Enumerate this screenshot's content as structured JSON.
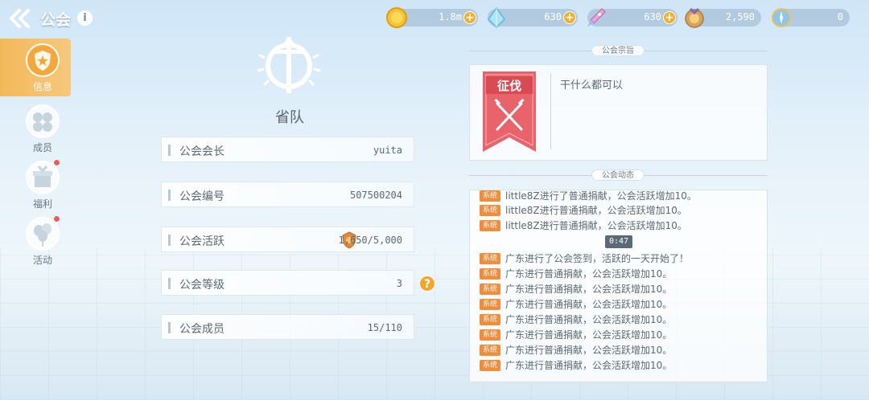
{
  "header": {
    "title": "公会",
    "info_icon": "i"
  },
  "resources": [
    {
      "icon": "gold-coin-icon",
      "value": "1.8m",
      "plus": true
    },
    {
      "icon": "crystal-icon",
      "value": "630",
      "plus": true
    },
    {
      "icon": "rocket-icon",
      "value": "630",
      "plus": true
    },
    {
      "icon": "medal-icon",
      "value": "2,590",
      "plus": false
    },
    {
      "icon": "compass-icon",
      "value": "0",
      "plus": false
    }
  ],
  "sidebar": {
    "items": [
      {
        "label": "信息",
        "active": true,
        "dot": false
      },
      {
        "label": "成员",
        "active": false,
        "dot": false
      },
      {
        "label": "福利",
        "active": false,
        "dot": true
      },
      {
        "label": "活动",
        "active": false,
        "dot": true
      }
    ]
  },
  "guild": {
    "name": "省队"
  },
  "info_rows": [
    {
      "label": "公会会长",
      "value": "yuita"
    },
    {
      "label": "公会编号",
      "value": "507500204"
    },
    {
      "label": "公会活跃",
      "value": "1,650/5,000"
    },
    {
      "label": "公会等级",
      "value": "3"
    },
    {
      "label": "公会成员",
      "value": "15/110"
    }
  ],
  "help_icon": "?",
  "purpose": {
    "tag": "公会宗旨",
    "banner_text": "征伐",
    "text": "干什么都可以"
  },
  "log": {
    "tag": "公会动态",
    "badge": "系统",
    "time": "0:47",
    "entries": [
      "little8Z进行了普通捐献，公会活跃增加10。",
      "little8Z进行普通捐献，公会活跃增加10。",
      "little8Z进行普通捐献，公会活跃增加10。",
      "广东进行了公会签到，活跃的一天开始了！",
      "广东进行普通捐献，公会活跃增加10。",
      "广东进行普通捐献，公会活跃增加10。",
      "广东进行普通捐献，公会活跃增加10。",
      "广东进行普通捐献，公会活跃增加10。",
      "广东进行普通捐献，公会活跃增加10。",
      "广东进行普通捐献，公会活跃增加10。",
      "广东进行普通捐献，公会活跃增加10。"
    ]
  },
  "colors": {
    "accent_orange": "#f3b85a",
    "badge_orange": "#f08c3a",
    "banner_red": "#e8636a",
    "notify_dot": "#f05a55"
  }
}
